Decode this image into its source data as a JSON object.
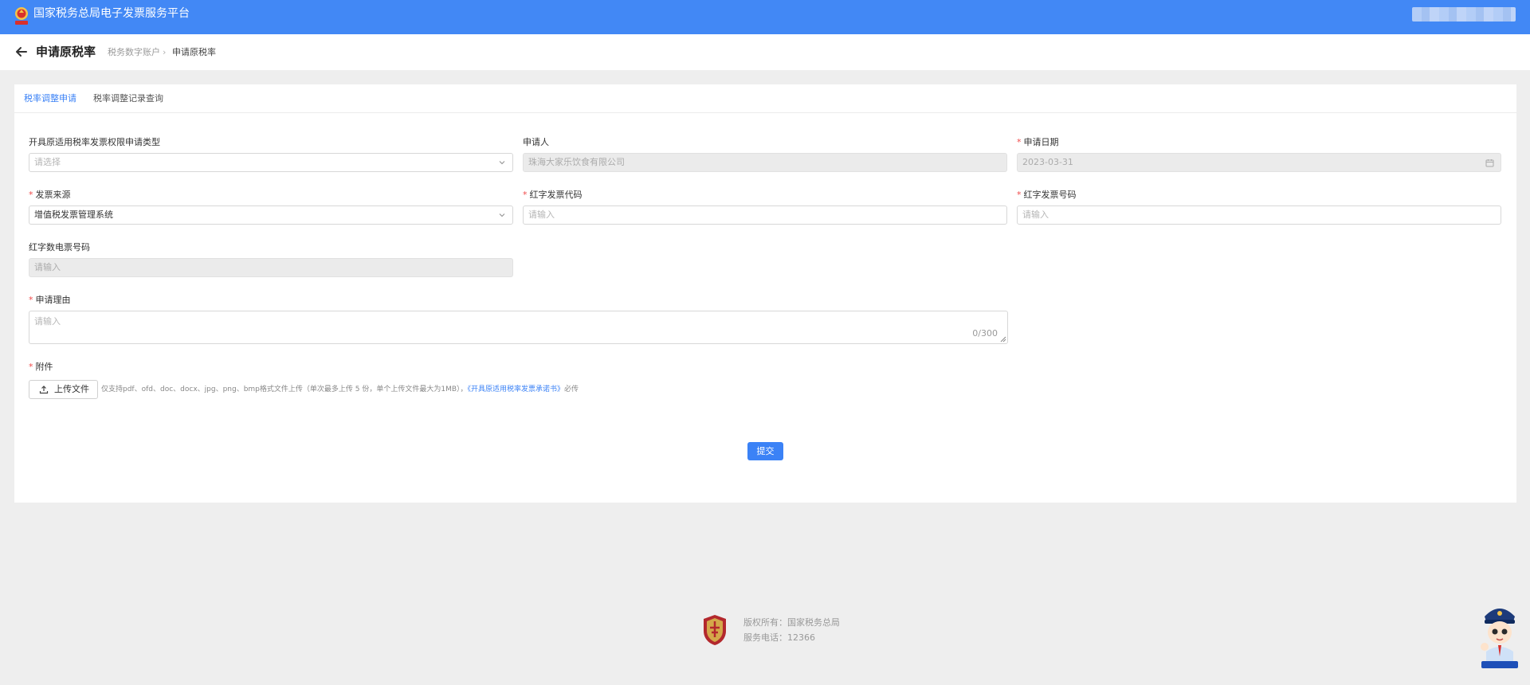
{
  "header": {
    "brand": "国家税务总局电子发票服务平台"
  },
  "page": {
    "title": "申请原税率",
    "breadcrumb": [
      "税务数字账户",
      "申请原税率"
    ],
    "breadcrumb_sep": "›"
  },
  "tabs": [
    {
      "label": "税率调整申请",
      "active": true
    },
    {
      "label": "税率调整记录查询",
      "active": false
    }
  ],
  "form": {
    "apply_type": {
      "label": "开具原适用税率发票权限申请类型",
      "placeholder": "请选择"
    },
    "applicant": {
      "label": "申请人",
      "value": "珠海大家乐饮食有限公司"
    },
    "apply_date": {
      "label": "申请日期",
      "value": "2023-03-31"
    },
    "invoice_source": {
      "label": "发票来源",
      "value": "增值税发票管理系统"
    },
    "red_invoice_code": {
      "label": "红字发票代码",
      "placeholder": "请输入"
    },
    "red_invoice_number": {
      "label": "红字发票号码",
      "placeholder": "请输入"
    },
    "red_electronic_number": {
      "label": "红字数电票号码",
      "placeholder": "请输入"
    },
    "reason": {
      "label": "申请理由",
      "placeholder": "请输入",
      "counter": "0/300"
    },
    "attachment": {
      "label": "附件",
      "button": "上传文件",
      "hint_prefix": "仅支持pdf、ofd、doc、docx、jpg、png、bmp格式文件上传（单次最多上传 5 份，单个上传文件最大为1MB），",
      "hint_link": "《开具原适用税率发票承诺书》",
      "hint_suffix": "必传"
    },
    "required_mark": "*",
    "submit": "提交"
  },
  "footer": {
    "copyright": "版权所有：国家税务总局",
    "phone": "服务电话：12366"
  },
  "icons": {
    "back": "arrow-left-icon",
    "select": "chevron-down-icon",
    "date": "calendar-icon",
    "upload": "upload-icon"
  },
  "colors": {
    "header": "#4288f5",
    "primary": "#3b82f6",
    "required": "#f04a4a",
    "background": "#eeeeee"
  }
}
